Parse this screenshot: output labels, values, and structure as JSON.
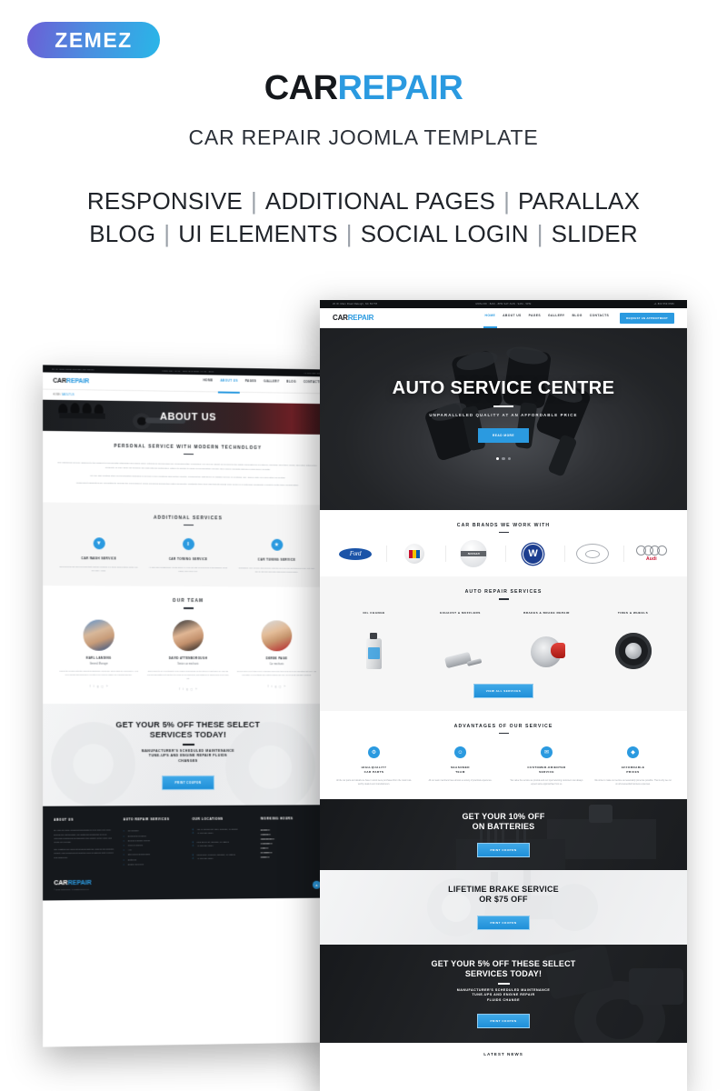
{
  "badge": {
    "text": "ZEMEZ"
  },
  "hero_heading": {
    "logo_dark": "CAR",
    "logo_blue": "REPAIR",
    "subtitle": "CAR REPAIR JOOMLA TEMPLATE",
    "features_row1": [
      "RESPONSIVE",
      "ADDITIONAL PAGES",
      "PARALLAX"
    ],
    "features_row2": [
      "BLOG",
      "UI ELEMENTS",
      "SOCIAL LOGIN",
      "SLIDER"
    ],
    "separator": "|"
  },
  "colors": {
    "accent": "#2b9ae0",
    "dark": "#15181c",
    "light_bg": "#f6f6f6"
  },
  "site": {
    "topbar": {
      "address": "20 W. Main Road Raleigh, NC 56778",
      "hours": "MON-FRI : 8AM - 8PM   SAT-SUN : 9AM - 5PM",
      "phone": "+1 800 559 6580"
    },
    "logo_dark": "CAR",
    "logo_blue": "REPAIR",
    "nav": [
      "HOME",
      "ABOUT US",
      "PAGES",
      "GALLERY",
      "BLOG",
      "CONTACTS"
    ],
    "cta": "REQUEST AN APPOINTMENT"
  },
  "home_page": {
    "hero": {
      "title": "AUTO SERVICE CENTRE",
      "subtitle": "UNPARALLELED QUALITY AT AN AFFORDABLE PRICE",
      "button": "READ MORE",
      "slide_count": 3,
      "active_slide": 1
    },
    "brands": {
      "title": "CAR BRANDS WE WORK WITH",
      "items": [
        "Ford",
        "Cadillac",
        "Nissan",
        "Volkswagen",
        "Toyota",
        "Audi"
      ]
    },
    "services": {
      "title": "AUTO REPAIR SERVICES",
      "items": [
        "OIL CHANGE",
        "EXHAUST & MUFFLERS",
        "BRAKES & BRAKE REPAIR",
        "TIRES & WHEELS"
      ],
      "button": "VIEW ALL SERVICES"
    },
    "advantages": {
      "title": "ADVANTAGES OF OUR SERVICE",
      "items": [
        {
          "icon": "gear-icon",
          "glyph": "⚙",
          "title": "HIGH-QUALITY\nCAR PARTS",
          "text": "All the car parts and details we have in stock were purchased from the most trust-worthy dealers and manufacturers."
        },
        {
          "icon": "person-icon",
          "glyph": "☺",
          "title": "SEASONED\nTEAM",
          "text": "All our team members have almost a century of practical experience."
        },
        {
          "icon": "chat-icon",
          "glyph": "✉",
          "title": "CUSTOMER-ORIENTED\nSERVICE",
          "text": "We value the service we provide and our loyal returning customers can always expect same approachae from us."
        },
        {
          "icon": "tag-icon",
          "glyph": "◆",
          "title": "AFFORDABLE\nPRICES",
          "text": "We strive to make our service as reasonably priced as possible. That is why we cut on all unessential business expenses."
        }
      ]
    },
    "promo_batteries": {
      "title": "GET YOUR 10% OFF\nON BATTERIES",
      "button": "PRINT COUPON"
    },
    "promo_brakes": {
      "title": "LIFETIME BRAKE SERVICE\nOR $75 OFF",
      "button": "PRINT COUPON"
    },
    "promo_select": {
      "title": "GET YOUR 5% OFF THESE SELECT\nSERVICES TODAY!",
      "sub": "MANUFACTURER'S SCHEDULED MAINTENANCE\nTUNE-UPS AND ENGINE REPAIR\nFLUIDS CHANGE",
      "button": "PRINT COUPON"
    },
    "latest_news_title": "LATEST NEWS"
  },
  "about_page": {
    "breadcrumb_home": "HOME",
    "breadcrumb_current": "ABOUT US",
    "page_title": "ABOUT US",
    "intro": {
      "title": "PERSONAL SERVICE WITH MODERN TECHNOLOGY",
      "paragraphs": [
        "Our CarRepair service adheres to the highest environmental standards and offers many options for drivers who are environmentally conscious. We recycle about 75 percent of the waste generated in our stores, including used tires, fluids, and other automotive products. In early 2009 we became the first national automotive retailer to switch to using environmentally-friendly steel wheel weights instead of lead wheel weights.",
        "We are also piloting other environmental programs in several of our locations around the country, including the first green oil change service in Portland, OR. Check with your local store for details.",
        "CarRepair teammates are committed to helping the environment. Team members around the nation frequently contribute their time and talents during local clean-up events and coordinate events to better their communities."
      ]
    },
    "additional_services": {
      "title": "ADDITIONAL SERVICES",
      "items": [
        {
          "icon": "wash-icon",
          "glyph": "▼",
          "title": "CAR WASH SERVICE",
          "text": "Experienced car drivers know that regular cleaning is a good appreciation of the car for many years."
        },
        {
          "icon": "tow-icon",
          "glyph": "‖",
          "title": "CAR TOWING SERVICE",
          "text": "All cars can occasionally break down. If your car has experienced a breakdown, don't panic, we'll help you."
        },
        {
          "icon": "tuning-icon",
          "glyph": "★",
          "title": "CAR TUNING SERVICE",
          "text": "Transform your vehicle appearance with the help of our car tuning service. Let your car be special and with maximum performance."
        }
      ]
    },
    "team": {
      "title": "OUR TEAM",
      "members": [
        {
          "name": "KARL\nLANDING",
          "role": "General Manager",
          "bio": "Karl is the person with the largest mechanical experience when cars are concerned. He's been fixing Lincolns when you still even moved eligible for a driving license."
        },
        {
          "name": "DAVID\nATTENBOROUGH",
          "role": "Senior car mechanic",
          "bio": "David used to be a lieutenant of an engineering squad on the 5th fleet. But since he and his few friends gathered together to found a new business, his passion for cars found a new way out."
        },
        {
          "name": "DEREK\nPAGE",
          "role": "Car mechanic",
          "bio": "Derek joined our team a few years ago and since then he's been an essential part of it. His expertise in everything car related makes him one of our most valuable workers."
        }
      ],
      "social_icons": [
        "facebook-icon",
        "twitter-icon",
        "google-icon",
        "instagram-icon",
        "rss-icon"
      ]
    },
    "promo": {
      "title": "GET YOUR 5% OFF THESE SELECT\nSERVICES TODAY!",
      "sub": "MANUFACTURER'S SCHEDULED MAINTENANCE\nTUNE-UPS AND ENGINE REPAIR FLUIDS\nCHANGES",
      "button": "PRINT COUPON"
    },
    "footer": {
      "about": {
        "title": "ABOUT US",
        "p1": "By now we have repaired thousands of new and retro cars. During the last decade, we gathered hundreds of loyal, returning customers all thanks to the quality of the work and repair we provide.",
        "p2": "Our masters are good at working with any kind of car damage, impact, and replacement and the price is always kept levered and balanced."
      },
      "services": {
        "title": "AUTO REPAIR SERVICES",
        "items": [
          "Oil Change",
          "Exhaust & Mufflers",
          "Brakes & Brake Repair",
          "Tires & Wheels",
          "A/C",
          "Steering & Suspension",
          "Batteries",
          "Engine Services"
        ]
      },
      "locations": {
        "title": "OUR LOCATIONS",
        "items": [
          {
            "addr": "411 W Church St #200, Orlando, FL 32802",
            "phone": "+1 800 559 5580"
          },
          {
            "addr": "66/3 Silver Ct, Orlando, FL 32801",
            "phone": "+1 800 559 5580"
          },
          {
            "addr": "6012 Curry Ford Rd, Orlando, FL 32802",
            "phone": "+1 800 559 5580"
          }
        ]
      },
      "hours": {
        "title": "WORKING HOURS",
        "items": [
          "MONDAY",
          "TUESDAY",
          "WEDNESDAY",
          "THURSDAY",
          "FRIDAY",
          "SATURDAY",
          "SUNDAY"
        ]
      },
      "logo_dark": "CAR",
      "logo_blue": "REPAIR",
      "copyright": "© 2017 CarRepair. All Rights Reserved.",
      "scroll_top_icon": "arrow-up-icon"
    }
  }
}
